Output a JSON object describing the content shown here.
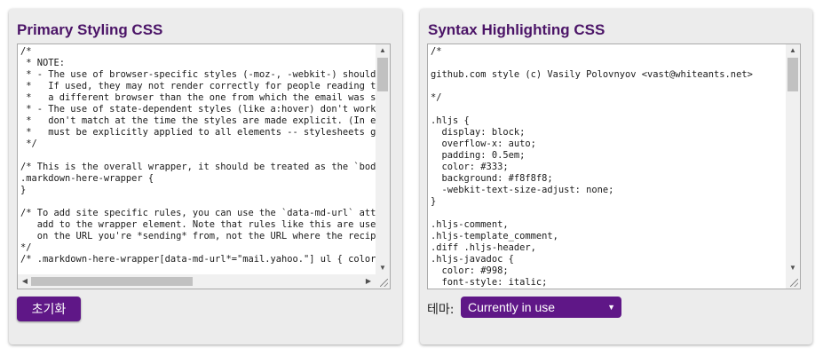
{
  "primary": {
    "title": "Primary Styling CSS",
    "code": [
      "/*",
      " * NOTE:",
      " * - The use of browser-specific styles (-moz-, -webkit-) should be avoided.",
      " *   If used, they may not render correctly for people reading the email in",
      " *   a different browser than the one from which the email was sent.",
      " * - The use of state-dependent styles (like a:hover) don't work because they",
      " *   don't match at the time the styles are made explicit. (In email, styles",
      " *   must be explicitly applied to all elements -- stylesheets get stripped.)",
      " */",
      "",
      "/* This is the overall wrapper, it should be treated as the `body` section. */",
      ".markdown-here-wrapper {",
      "}",
      "",
      "/* To add site specific rules, you can use the `data-md-url` attribute that we",
      "   add to the wrapper element. Note that rules like this are used depending",
      "   on the URL you're *sending* from, not the URL where the recipient views it.",
      "*/",
      "/* .markdown-here-wrapper[data-md-url*=\"mail.yahoo.\"] ul { color: red; } */"
    ],
    "reset_button": "초기화"
  },
  "syntax": {
    "title": "Syntax Highlighting CSS",
    "code": [
      "/*",
      "",
      "github.com style (c) Vasily Polovnyov <vast@whiteants.net>",
      "",
      "*/",
      "",
      ".hljs {",
      "  display: block;",
      "  overflow-x: auto;",
      "  padding: 0.5em;",
      "  color: #333;",
      "  background: #f8f8f8;",
      "  -webkit-text-size-adjust: none;",
      "}",
      "",
      ".hljs-comment,",
      ".hljs-template_comment,",
      ".diff .hljs-header,",
      ".hljs-javadoc {",
      "  color: #998;",
      "  font-style: italic;",
      "}"
    ],
    "theme_label": "테마:",
    "theme_selected": "Currently in use"
  },
  "icons": {
    "up": "▲",
    "down": "▼",
    "left": "◀",
    "right": "▶",
    "caret": "▼"
  },
  "colors": {
    "accent": "#5f1787",
    "title": "#4b1467",
    "panel": "#ececec"
  }
}
